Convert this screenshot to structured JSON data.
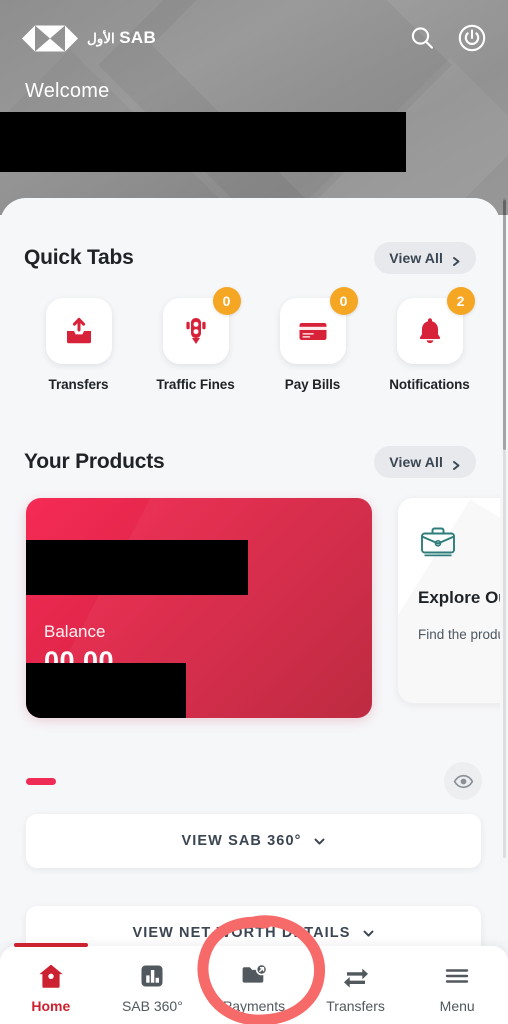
{
  "header": {
    "logo_arabic": "الأول",
    "logo_latin": "SAB",
    "search_icon": "search-icon",
    "power_icon": "power-icon",
    "welcome_text": "Welcome",
    "user_name_redacted": ""
  },
  "quick_tabs": {
    "title": "Quick Tabs",
    "view_all_label": "View All",
    "items": [
      {
        "label": "Transfers",
        "icon": "outbox-upload-icon",
        "badge": null
      },
      {
        "label": "Traffic Fines",
        "icon": "traffic-light-icon",
        "badge": "0"
      },
      {
        "label": "Pay Bills",
        "icon": "credit-card-icon",
        "badge": "0"
      },
      {
        "label": "Notifications",
        "icon": "bell-icon",
        "badge": "2"
      }
    ]
  },
  "your_products": {
    "title": "Your Products",
    "view_all_label": "View All",
    "account_card": {
      "name_redacted": "",
      "balance_label": "Balance",
      "balance_value": "00.00",
      "balance_redacted": ""
    },
    "explore_card": {
      "icon": "briefcase-icon",
      "title": "Explore Ou",
      "subtitle": "Find the produ\nyour needs"
    }
  },
  "carousel": {
    "active_dot_index": 0,
    "toggle_visibility_icon": "eye-icon"
  },
  "actions": {
    "view_sab_360_label": "VIEW SAB 360°",
    "view_net_worth_label": "VIEW NET WORTH DETAILS",
    "chevron_icon": "chevron-down-icon"
  },
  "bottom_nav": {
    "items": [
      {
        "label": "Home",
        "icon": "home-icon",
        "active": true
      },
      {
        "label": "SAB 360°",
        "icon": "bar-chart-icon",
        "active": false
      },
      {
        "label": "Payments",
        "icon": "payments-folder-icon",
        "active": false
      },
      {
        "label": "Transfers",
        "icon": "transfer-arrows-icon",
        "active": false
      },
      {
        "label": "Menu",
        "icon": "hamburger-menu-icon",
        "active": false
      }
    ]
  },
  "annotation": {
    "shape": "hand-drawn-circle",
    "target": "Payments",
    "color": "#f76a6a"
  },
  "colors": {
    "brand_red": "#cc2131",
    "card_pink": "#f52b55",
    "card_dark_red": "#bb2239",
    "badge_amber": "#f5a623",
    "teal_icon": "#2e7d7b",
    "sheet_bg": "#f6f7f9"
  }
}
